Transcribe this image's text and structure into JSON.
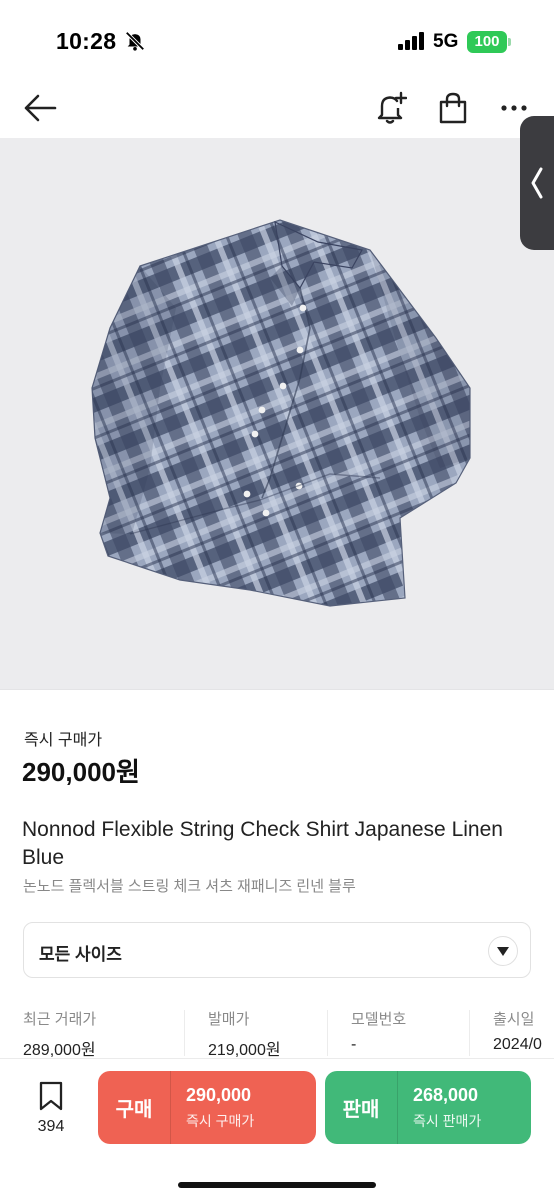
{
  "status_bar": {
    "time": "10:28",
    "network": "5G",
    "battery": "100"
  },
  "top_nav": {
    "icons": [
      "back-arrow-icon",
      "bell-plus-icon",
      "shopping-bag-icon",
      "more-dots-icon"
    ]
  },
  "product": {
    "image_alt": "check shirt",
    "price_label": "즉시 구매가",
    "price": "290,000원",
    "title_en": "Nonnod Flexible String Check Shirt Japanese Linen Blue",
    "title_ko": "논노드 플렉서블 스트링 체크 셔츠 재패니즈 린넨 블루"
  },
  "size_select": {
    "value": "모든 사이즈"
  },
  "info": {
    "recent_label": "최근 거래가",
    "recent_value": "289,000원",
    "release_price_label": "발매가",
    "release_price_value": "219,000원",
    "model_label": "모델번호",
    "model_value": "-",
    "release_date_label": "출시일",
    "release_date_value": "2024/0"
  },
  "bottom_bar": {
    "bookmark_count": "394",
    "buy": {
      "label": "구매",
      "price": "290,000",
      "sub": "즉시 구매가"
    },
    "sell": {
      "label": "판매",
      "price": "268,000",
      "sub": "즉시 판매가"
    }
  },
  "colors": {
    "buy": "#ef6253",
    "sell": "#41b979",
    "image_bg": "#ececee",
    "battery": "#2fc957"
  }
}
